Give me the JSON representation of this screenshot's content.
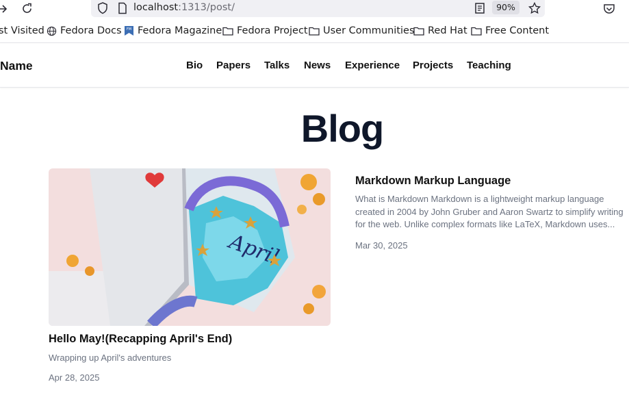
{
  "browser": {
    "url_host": "localhost",
    "url_path": ":1313/post/",
    "zoom": "90%"
  },
  "bookmarks": [
    {
      "label": "st Visited",
      "icon": "none"
    },
    {
      "label": "Fedora Docs",
      "icon": "globe-icon"
    },
    {
      "label": "Fedora Magazine",
      "icon": "fedora-magazine-icon"
    },
    {
      "label": "Fedora Project",
      "icon": "folder-icon"
    },
    {
      "label": "User Communities",
      "icon": "folder-icon"
    },
    {
      "label": "Red Hat",
      "icon": "folder-icon"
    },
    {
      "label": "Free Content",
      "icon": "folder-icon"
    }
  ],
  "site": {
    "name": "Name",
    "nav": [
      "Bio",
      "Papers",
      "Talks",
      "News",
      "Experience",
      "Projects",
      "Teaching"
    ]
  },
  "page": {
    "title": "Blog"
  },
  "posts": [
    {
      "title": "Hello May!(Recapping April's End)",
      "description": "Wrapping up April's adventures",
      "date": "Apr 28, 2025",
      "image_text": "April"
    },
    {
      "title": "Markdown Markup Language",
      "description_lines": [
        "What is Markdown Markdown is a lightweight markup language",
        "created in 2004 by John Gruber and Aaron Swartz to simplify writing",
        "for the web. Unlike complex formats like LaTeX, Markdown uses..."
      ],
      "date": "Mar 30, 2025"
    }
  ],
  "colors": {
    "title": "#0f172a",
    "muted": "#6b7280",
    "urlbar": "#f0f0f4"
  }
}
